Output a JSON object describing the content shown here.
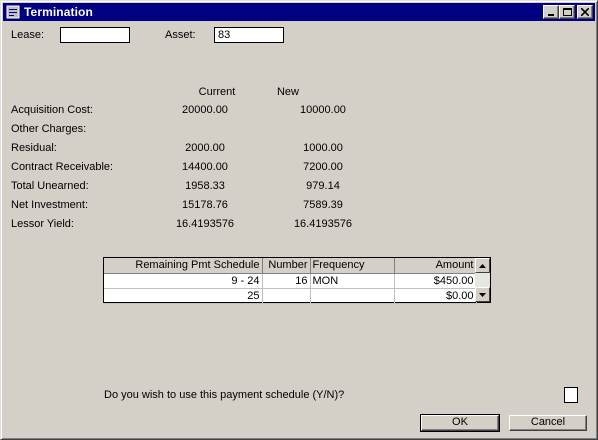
{
  "window": {
    "title": "Termination",
    "icon": "document-icon"
  },
  "fields": {
    "lease_label": "Lease:",
    "lease_value": "",
    "asset_label": "Asset:",
    "asset_value": "83"
  },
  "columns": {
    "current": "Current",
    "new": "New"
  },
  "rows": [
    {
      "label": "Acquisition Cost:",
      "current": "20000.00",
      "new": "10000.00"
    },
    {
      "label": "Other Charges:",
      "current": "",
      "new": ""
    },
    {
      "label": "Residual:",
      "current": "2000.00",
      "new": "1000.00"
    },
    {
      "label": "Contract Receivable:",
      "current": "14400.00",
      "new": "7200.00"
    },
    {
      "label": "Total Unearned:",
      "current": "1958.33",
      "new": "979.14"
    },
    {
      "label": "Net Investment:",
      "current": "15178.76",
      "new": "7589.39"
    },
    {
      "label": "Lessor Yield:",
      "current": "16.4193576",
      "new": "16.4193576"
    }
  ],
  "schedule": {
    "headers": [
      "Remaining Pmt Schedule",
      "Number",
      "Frequency",
      "Amount"
    ],
    "rows": [
      [
        "9 -  24",
        "16",
        "MON",
        "$450.00"
      ],
      [
        "25",
        "",
        "",
        "$0.00"
      ]
    ]
  },
  "prompt": "Do you wish to use this payment schedule (Y/N)?",
  "buttons": {
    "ok": "OK",
    "cancel": "Cancel"
  }
}
